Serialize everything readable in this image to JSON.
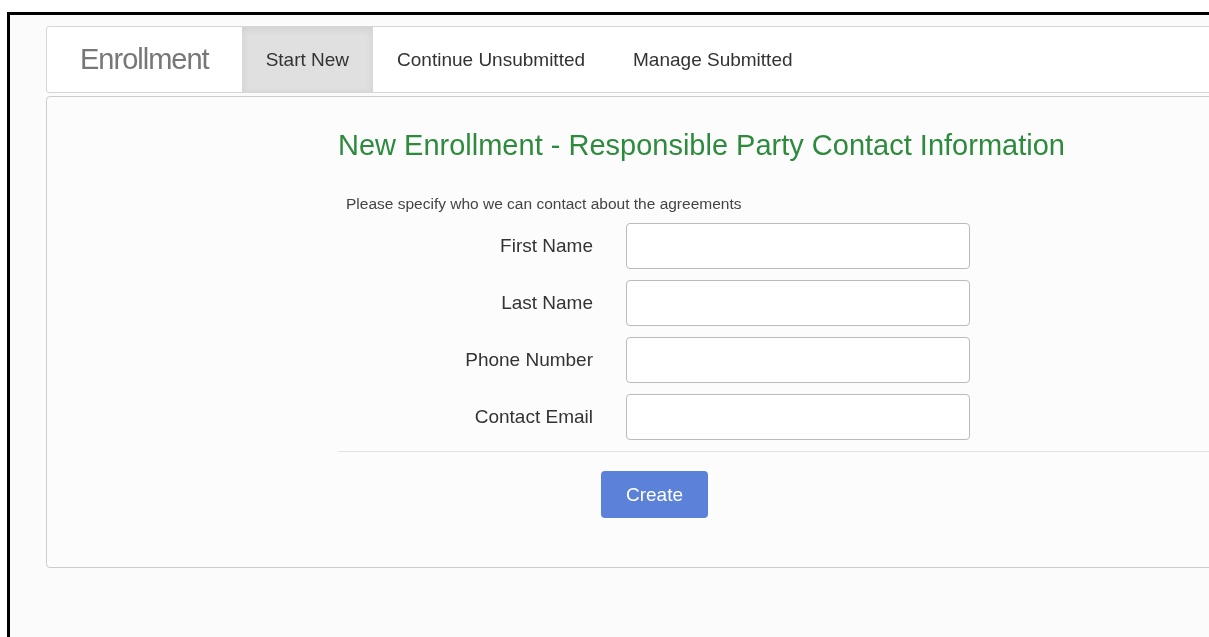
{
  "navbar": {
    "brand": "Enrollment",
    "tabs": [
      {
        "label": "Start New",
        "selected": true
      },
      {
        "label": "Continue Unsubmitted",
        "selected": false
      },
      {
        "label": "Manage Submitted",
        "selected": false
      }
    ]
  },
  "form": {
    "heading": "New Enrollment - Responsible Party Contact Information",
    "description": "Please specify who we can contact about the agreements",
    "fields": [
      {
        "label": "First Name"
      },
      {
        "label": "Last Name"
      },
      {
        "label": "Phone Number"
      },
      {
        "label": "Contact Email"
      }
    ],
    "submit_button": "Create"
  }
}
